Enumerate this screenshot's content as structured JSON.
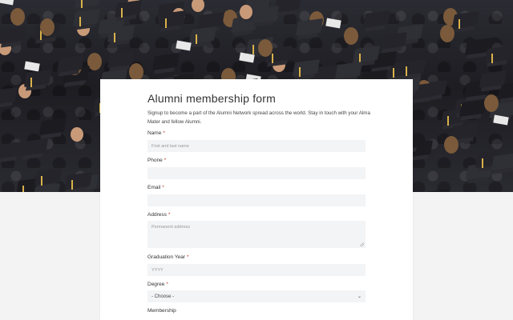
{
  "form": {
    "title": "Alumni membership form",
    "description": "Signup to become a part of the Alumni Network spread across the world. Stay in touch with your Alma Mater and fellow Alumni.",
    "required_mark": "*",
    "fields": {
      "name": {
        "label": "Name",
        "placeholder": "First and last name"
      },
      "phone": {
        "label": "Phone",
        "placeholder": ""
      },
      "email": {
        "label": "Email",
        "placeholder": ""
      },
      "address": {
        "label": "Address",
        "placeholder": "Permanent address"
      },
      "graduation_year": {
        "label": "Graduation Year",
        "placeholder": "YYYY"
      },
      "degree": {
        "label": "Degree",
        "selected": "- Choose -"
      },
      "membership": {
        "label": "Membership"
      }
    }
  },
  "colors": {
    "required": "#c0392b",
    "field_bg": "#f3f4f6",
    "page_bg": "#f3f3f3"
  }
}
